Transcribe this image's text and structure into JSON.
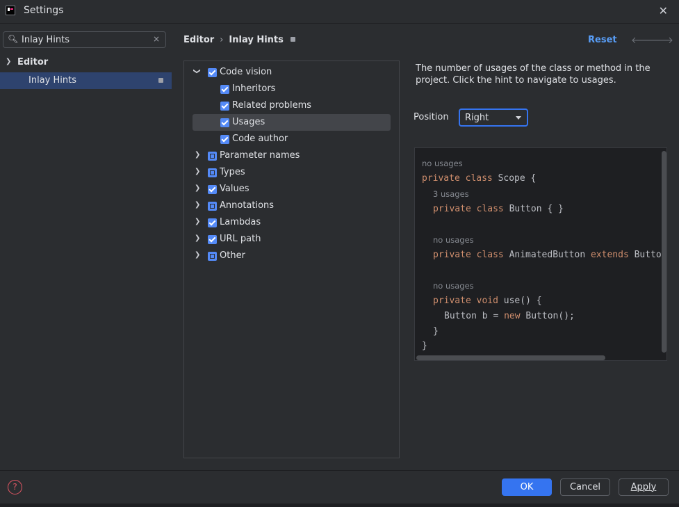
{
  "window": {
    "title": "Settings",
    "close": "✕"
  },
  "search": {
    "value": "Inlay Hints",
    "clear": "×"
  },
  "nav_tree": [
    {
      "label": "Editor",
      "expanded": true
    },
    {
      "label": "Inlay Hints",
      "selected": true
    }
  ],
  "breadcrumb": {
    "parent": "Editor",
    "separator": "›",
    "current": "Inlay Hints"
  },
  "header": {
    "reset": "Reset",
    "back": "🡐",
    "forward": "🡒"
  },
  "options": [
    {
      "label": "Code vision",
      "state": "checked",
      "expandable": true,
      "expanded": true,
      "level": 0
    },
    {
      "label": "Inheritors",
      "state": "checked",
      "level": 1
    },
    {
      "label": "Related problems",
      "state": "checked",
      "level": 1
    },
    {
      "label": "Usages",
      "state": "checked",
      "level": 1,
      "selected": true
    },
    {
      "label": "Code author",
      "state": "checked",
      "level": 1
    },
    {
      "label": "Parameter names",
      "state": "partial",
      "expandable": true,
      "level": 0
    },
    {
      "label": "Types",
      "state": "partial",
      "expandable": true,
      "level": 0
    },
    {
      "label": "Values",
      "state": "checked",
      "expandable": true,
      "level": 0
    },
    {
      "label": "Annotations",
      "state": "partial",
      "expandable": true,
      "level": 0
    },
    {
      "label": "Lambdas",
      "state": "checked",
      "expandable": true,
      "level": 0
    },
    {
      "label": "URL path",
      "state": "checked",
      "expandable": true,
      "level": 0
    },
    {
      "label": "Other",
      "state": "partial",
      "expandable": true,
      "level": 0
    }
  ],
  "description": "The number of usages of the class or method in the project. Click the hint to navigate to usages.",
  "position": {
    "label": "Position",
    "value": "Right"
  },
  "code_preview": {
    "hint_no_usages_1": "no usages",
    "line1_kw": "private class",
    "line1_rest": " Scope {",
    "hint_3_usages": "3 usages",
    "line2_kw": "private class",
    "line2_rest": " Button { }",
    "hint_no_usages_2": "no usages",
    "line3_kw1": "private class",
    "line3_mid": " AnimatedButton ",
    "line3_kw2": "extends",
    "line3_rest": " Butto",
    "hint_no_usages_3": "no usages",
    "line4_kw1": "private",
    "line4_kw2": " void",
    "line4_rest": " use() {",
    "line5_pre": "Button b = ",
    "line5_kw": "new",
    "line5_rest": " Button();",
    "line6": "}",
    "line7": "}"
  },
  "footer": {
    "help": "?",
    "ok": "OK",
    "cancel": "Cancel",
    "apply": "Apply"
  },
  "colors": {
    "accent": "#3574f0",
    "selection": "#2e436e",
    "keyword": "#cf8e6d",
    "link": "#589df6"
  }
}
